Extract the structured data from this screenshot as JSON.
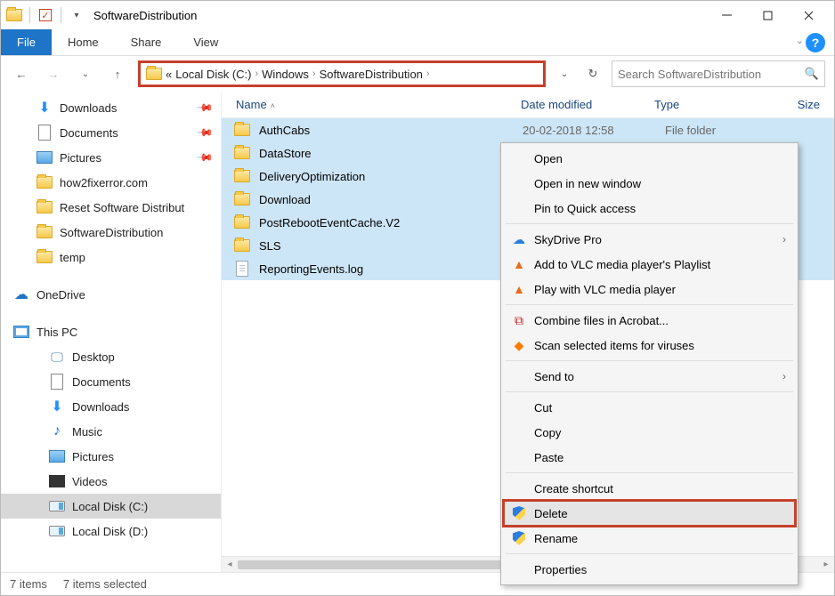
{
  "window": {
    "title": "SoftwareDistribution"
  },
  "ribbon": {
    "file": "File",
    "home": "Home",
    "share": "Share",
    "view": "View"
  },
  "breadcrumb": {
    "overflow": "«",
    "parts": [
      "Local Disk (C:)",
      "Windows",
      "SoftwareDistribution"
    ]
  },
  "search": {
    "placeholder": "Search SoftwareDistribution"
  },
  "sidebar": {
    "quick": [
      {
        "icon": "download",
        "label": "Downloads",
        "pinned": true
      },
      {
        "icon": "doc",
        "label": "Documents",
        "pinned": true
      },
      {
        "icon": "pic",
        "label": "Pictures",
        "pinned": true
      },
      {
        "icon": "folder",
        "label": "how2fixerror.com"
      },
      {
        "icon": "folder",
        "label": "Reset Software Distribut"
      },
      {
        "icon": "folder",
        "label": "SoftwareDistribution"
      },
      {
        "icon": "folder",
        "label": "temp"
      }
    ],
    "onedrive": {
      "label": "OneDrive"
    },
    "thispc": {
      "label": "This PC"
    },
    "pcitems": [
      {
        "icon": "desk",
        "label": "Desktop"
      },
      {
        "icon": "doc",
        "label": "Documents"
      },
      {
        "icon": "download",
        "label": "Downloads"
      },
      {
        "icon": "music",
        "label": "Music"
      },
      {
        "icon": "pic",
        "label": "Pictures"
      },
      {
        "icon": "video",
        "label": "Videos"
      },
      {
        "icon": "disk",
        "label": "Local Disk (C:)",
        "selected": true
      },
      {
        "icon": "disk",
        "label": "Local Disk (D:)"
      }
    ]
  },
  "columns": {
    "name": "Name",
    "date": "Date modified",
    "type": "Type",
    "size": "Size"
  },
  "items": [
    {
      "icon": "folder",
      "name": "AuthCabs",
      "date": "20-02-2018 12:58",
      "type": "File folder"
    },
    {
      "icon": "folder",
      "name": "DataStore"
    },
    {
      "icon": "folder",
      "name": "DeliveryOptimization"
    },
    {
      "icon": "folder",
      "name": "Download"
    },
    {
      "icon": "folder",
      "name": "PostRebootEventCache.V2"
    },
    {
      "icon": "folder",
      "name": "SLS"
    },
    {
      "icon": "file",
      "name": "ReportingEvents.log"
    }
  ],
  "context_menu": [
    {
      "label": "Open"
    },
    {
      "label": "Open in new window"
    },
    {
      "label": "Pin to Quick access"
    },
    {
      "sep": true
    },
    {
      "icon": "sky",
      "label": "SkyDrive Pro",
      "submenu": true
    },
    {
      "icon": "vlc",
      "label": "Add to VLC media player's Playlist"
    },
    {
      "icon": "vlc",
      "label": "Play with VLC media player"
    },
    {
      "sep": true
    },
    {
      "icon": "acro",
      "label": "Combine files in Acrobat..."
    },
    {
      "icon": "av",
      "label": "Scan selected items for viruses"
    },
    {
      "sep": true
    },
    {
      "label": "Send to",
      "submenu": true
    },
    {
      "sep": true
    },
    {
      "label": "Cut"
    },
    {
      "label": "Copy"
    },
    {
      "label": "Paste"
    },
    {
      "sep": true
    },
    {
      "label": "Create shortcut"
    },
    {
      "icon": "shield",
      "label": "Delete",
      "highlight": true
    },
    {
      "icon": "shield",
      "label": "Rename"
    },
    {
      "sep": true
    },
    {
      "label": "Properties"
    }
  ],
  "status": {
    "count": "7 items",
    "selected": "7 items selected"
  }
}
